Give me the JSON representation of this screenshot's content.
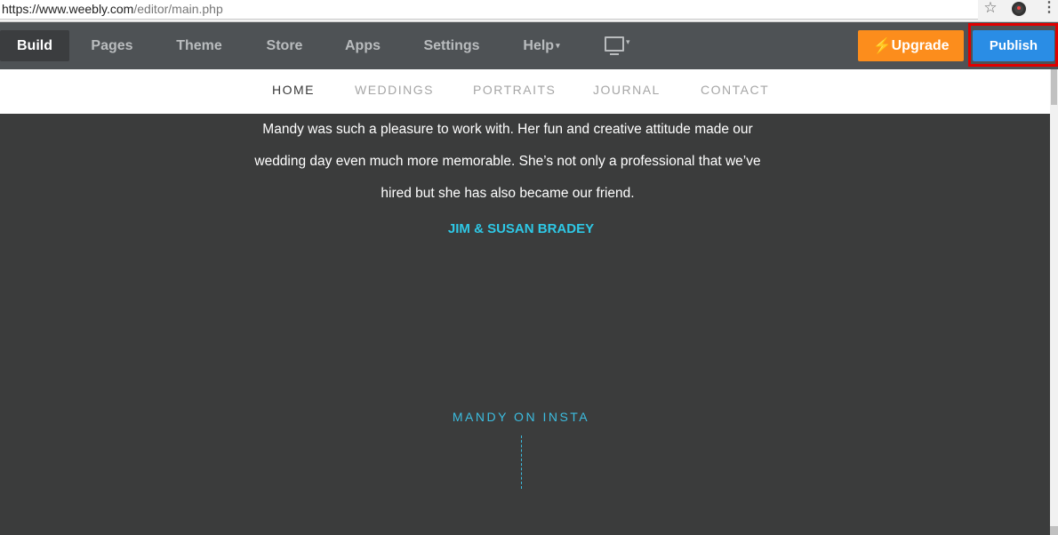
{
  "browser": {
    "url_host": "https://www.weebly.com",
    "url_path": "/editor/main.php",
    "star_icon": "☆",
    "kebab_icon": "⋮"
  },
  "toolbar": {
    "tabs": [
      {
        "label": "Build"
      },
      {
        "label": "Pages"
      },
      {
        "label": "Theme"
      },
      {
        "label": "Store"
      },
      {
        "label": "Apps"
      },
      {
        "label": "Settings"
      },
      {
        "label": "Help"
      }
    ],
    "help_caret": "▾",
    "device_caret": "▾",
    "upgrade_icon": "⚡",
    "upgrade_label": "Upgrade",
    "publish_label": "Publish"
  },
  "site_nav": {
    "items": [
      {
        "label": "HOME"
      },
      {
        "label": "WEDDINGS"
      },
      {
        "label": "PORTRAITS"
      },
      {
        "label": "JOURNAL"
      },
      {
        "label": "CONTACT"
      }
    ]
  },
  "content": {
    "testimonial_lines": [
      "Mandy was such a pleasure to work with. Her fun and creative attitude made our",
      "wedding day even much more memorable. She’s not only a professional that we’ve",
      "hired but she has also became our friend."
    ],
    "author": "JIM & SUSAN BRADEY",
    "insta_heading": "MANDY ON INSTA"
  },
  "colors": {
    "toolbar_bg": "#4e5255",
    "upgrade": "#fc8d1c",
    "publish": "#2a8de5",
    "highlight": "#e00000",
    "content_bg": "#3b3c3c",
    "accent": "#2ec8e6"
  },
  "icons": [
    "star-icon",
    "extension-icon",
    "kebab-menu-icon",
    "caret-down-icon",
    "monitor-icon",
    "bolt-icon"
  ]
}
